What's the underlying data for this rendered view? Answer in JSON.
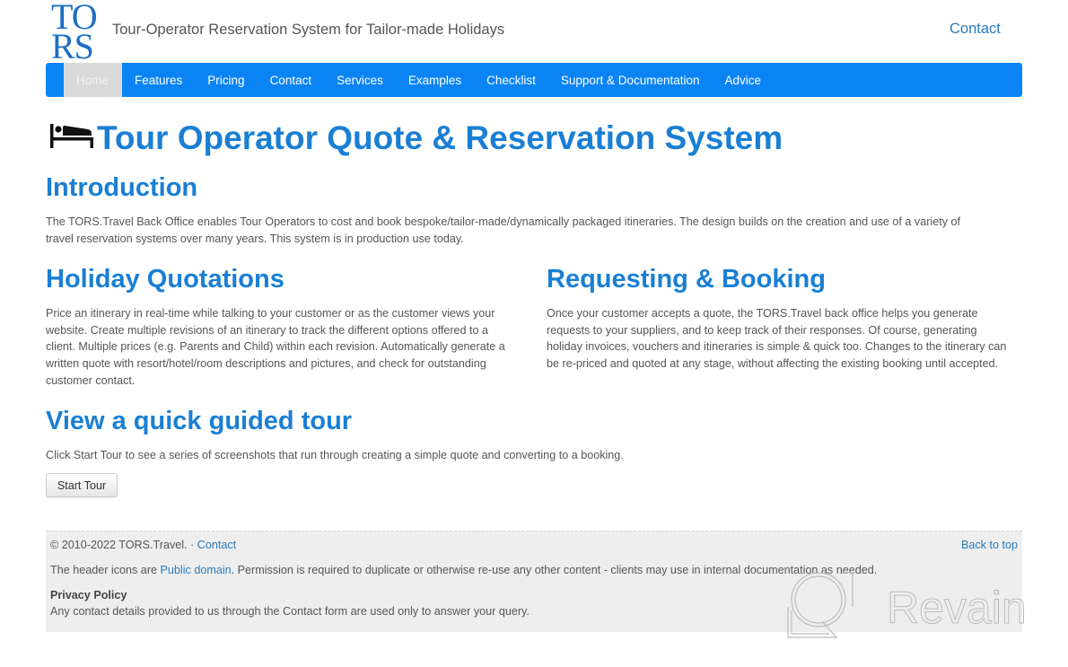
{
  "header": {
    "logo_line1": "TO",
    "logo_line2": "RS",
    "tagline": "Tour-Operator Reservation System for Tailor-made Holidays",
    "contact_link": "Contact"
  },
  "nav": {
    "items": [
      {
        "label": "Home",
        "active": true
      },
      {
        "label": "Features"
      },
      {
        "label": "Pricing"
      },
      {
        "label": "Contact"
      },
      {
        "label": "Services"
      },
      {
        "label": "Examples"
      },
      {
        "label": "Checklist"
      },
      {
        "label": "Support & Documentation"
      },
      {
        "label": "Advice"
      }
    ]
  },
  "main": {
    "title_icon": "bed-icon",
    "title": "Tour Operator Quote & Reservation System",
    "intro": {
      "heading": "Introduction",
      "line1": "The TORS.Travel Back Office enables Tour Operators to cost and book bespoke/tailor-made/dynamically packaged itineraries. The design builds on the creation and use of a variety of",
      "line2": "travel reservation systems over many years. This system is in production use today."
    },
    "quotations": {
      "heading": "Holiday Quotations",
      "lines": [
        "Price an itinerary in real-time while talking to your customer or as the customer views your",
        "website. Create multiple revisions of an itinerary to track the different options offered to a",
        "client. Multiple prices (e.g. Parents and Child) within each revision. Automatically generate a",
        "written quote with resort/hotel/room descriptions and pictures, and check for outstanding",
        "customer contact."
      ]
    },
    "booking": {
      "heading": "Requesting & Booking",
      "lines": [
        "Once your customer accepts a quote, the TORS.Travel back office helps you generate",
        "requests to your suppliers, and to keep track of their responses. Of course, generating",
        "holiday invoices, vouchers and itineraries is simple & quick too. Changes to the itinerary can",
        "be re-priced and quoted at any stage, without affecting the existing booking until accepted."
      ]
    },
    "tour": {
      "heading": "View a quick guided tour",
      "text": "Click Start Tour to see a series of screenshots that run through creating a simple quote and converting to a booking.",
      "button": "Start Tour"
    }
  },
  "footer": {
    "copyright": "© 2010-2022 TORS.Travel.",
    "separator": " · ",
    "contact_link": "Contact",
    "back_to_top": "Back to top",
    "icons_prefix": "The header icons are ",
    "public_domain_link": "Public domain",
    "icons_suffix": ". Permission is required to duplicate or otherwise re-use any other content - clients may use in internal documentation as needed.",
    "privacy_heading": "Privacy Policy",
    "privacy_text": "Any contact details provided to us through the Contact form are used only to answer your query."
  },
  "watermark": {
    "text": "Revain"
  }
}
